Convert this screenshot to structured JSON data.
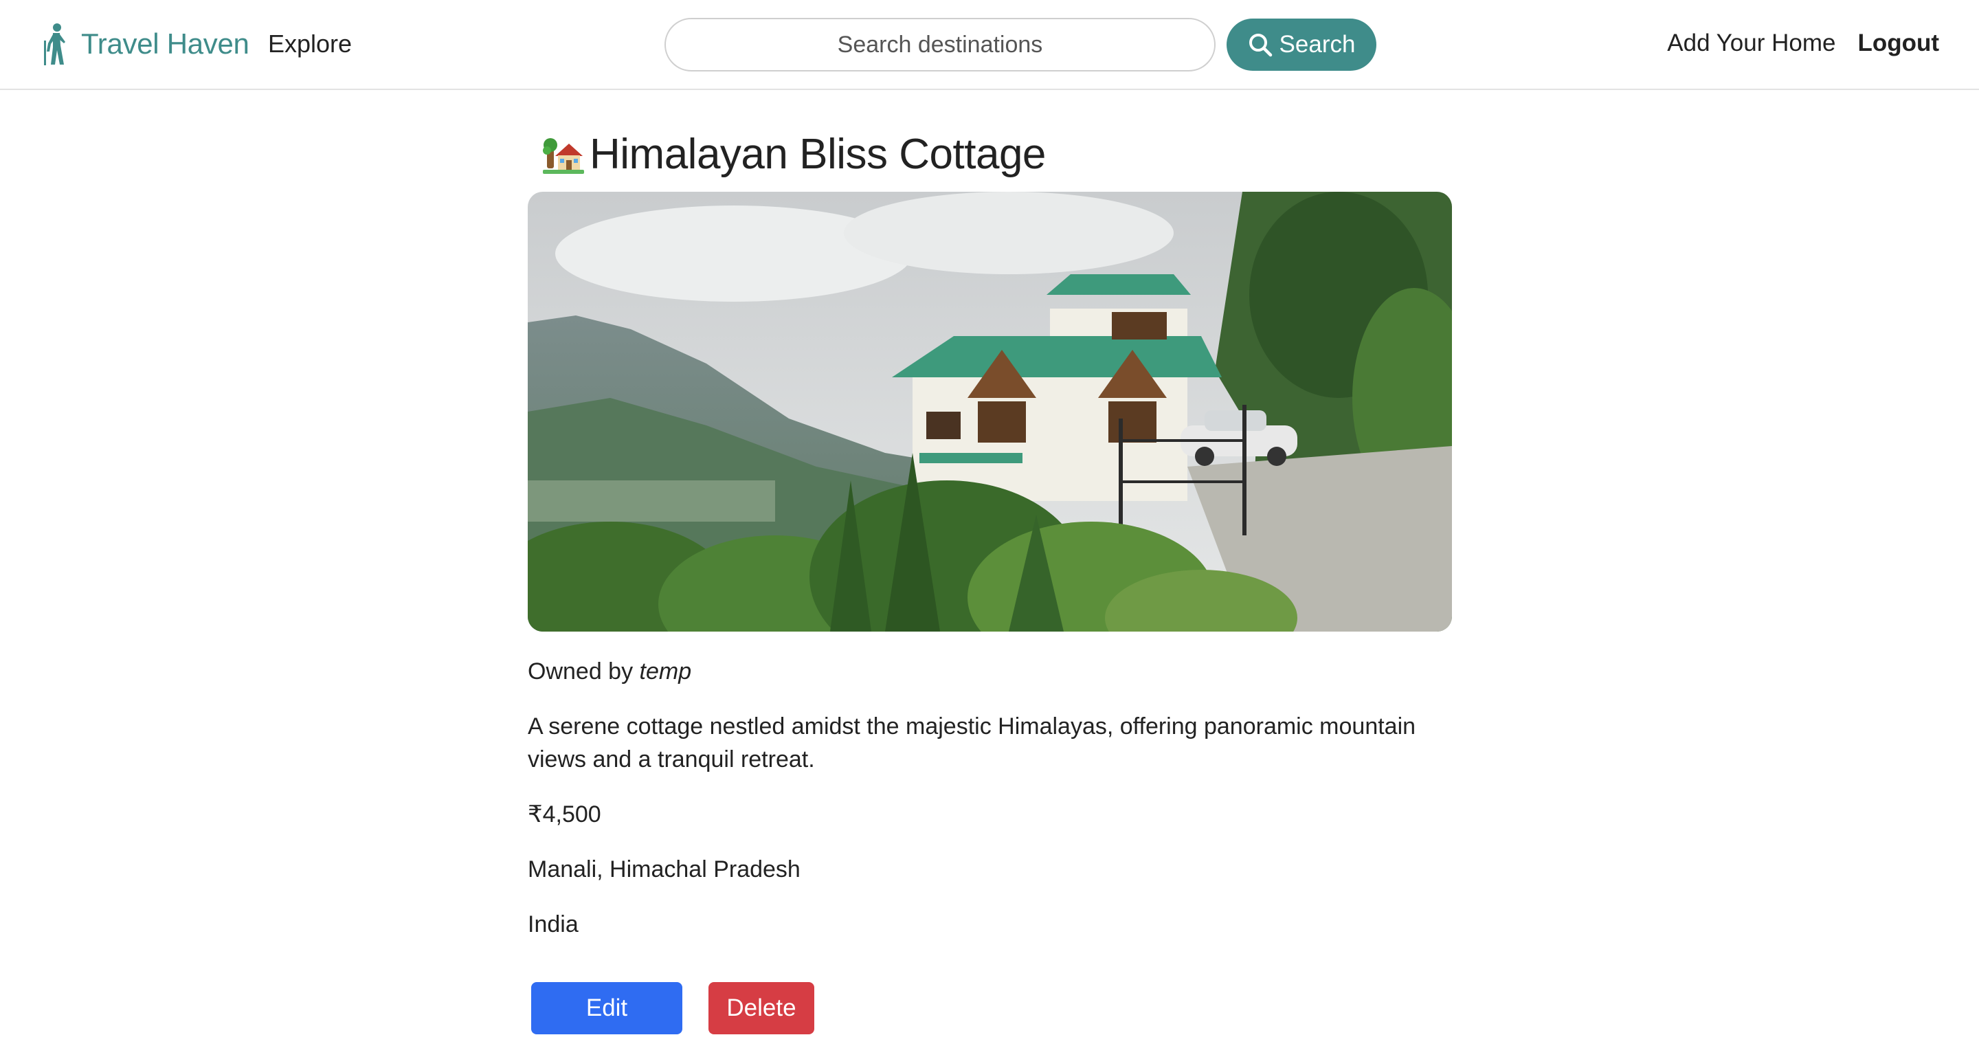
{
  "navbar": {
    "brand": "Travel Haven",
    "explore": "Explore",
    "search_placeholder": "Search destinations",
    "search_button": "Search",
    "add_home": "Add Your Home",
    "logout": "Logout"
  },
  "listing": {
    "title": "Himalayan Bliss Cottage",
    "owned_by_label": "Owned by",
    "owner": "temp",
    "description": "A serene cottage nestled amidst the majestic Himalayas, offering panoramic mountain views and a tranquil retreat.",
    "price": "₹4,500",
    "location": "Manali, Himachal Pradesh",
    "country": "India"
  },
  "actions": {
    "edit": "Edit",
    "delete": "Delete"
  },
  "colors": {
    "brand_teal": "#3f8c8a",
    "edit_blue": "#2f6cf2",
    "delete_red": "#d63d44"
  }
}
